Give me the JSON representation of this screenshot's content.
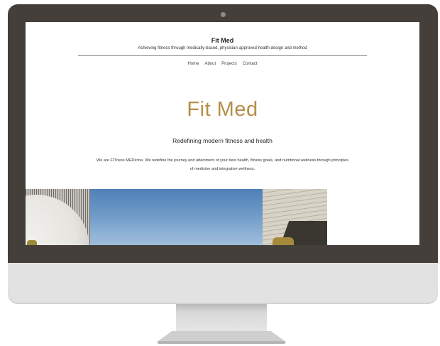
{
  "site": {
    "title": "Fit Med",
    "tagline": "Achieving fitness through medically-based, physician-approved health design and method"
  },
  "nav": {
    "items": [
      {
        "label": "Home"
      },
      {
        "label": "About"
      },
      {
        "label": "Projects"
      },
      {
        "label": "Contact"
      }
    ]
  },
  "hero": {
    "title": "Fit Med",
    "subtitle": "Redefining modern fitness and health",
    "body": "We are FITness MEDicine.  We redefine the journey and attainment of your best health, fitness goals, and nutritional wellness through principles of medicine and integrative wellness."
  },
  "colors": {
    "accent": "#b58d48",
    "bezel": "#443f3b",
    "chin": "#e2e2e2"
  },
  "icons": {
    "camera": "camera-icon"
  }
}
